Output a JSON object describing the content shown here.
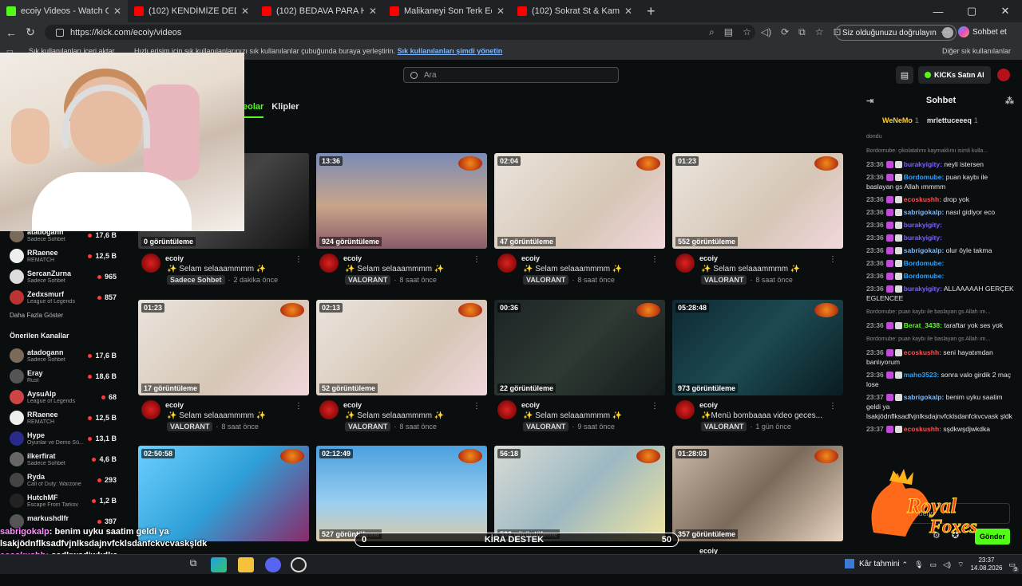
{
  "browser": {
    "tabs": [
      {
        "title": "ecoiy Videos - Watch On-Demand",
        "fav": "#53fc18"
      },
      {
        "title": "(102) KENDİMİZE DEDEKTİF TUTTU",
        "fav": "#ff0000"
      },
      {
        "title": "(102) BEDAVA PARA HİLESİ BULUP",
        "fav": "#ff0000"
      },
      {
        "title": "Malikaneyi Son Terk Eden Kazanır",
        "fav": "#ff0000"
      },
      {
        "title": "(102) Sokrat St & Kamufle & Ados",
        "fav": "#ff0000"
      }
    ],
    "url": "https://kick.com/ecoiy/videos",
    "verify_label": "Siz olduğunuzu doğrulayın",
    "copilot_label": "Sohbet et",
    "bookmarks": {
      "import": "Sık kullanılanları içeri aktar",
      "hint": "Hızlı erişim için sık kullanılanlarınızı sık kullanılanlar çubuğunda buraya yerleştirin.",
      "manage_link": "Sık kullanılanları şimdi yönetin",
      "other": "Diğer sık kullanılanlar"
    }
  },
  "header": {
    "search_placeholder": "Ara",
    "kicks_label": "KICKs Satın Al"
  },
  "content_tabs": {
    "videos": "eolar",
    "clips": "Klipler"
  },
  "sidebar": {
    "followed": [
      {
        "name": "atadogann",
        "category": "Sadece Sohbet",
        "viewers": "17,6 B",
        "color": "#7a6a5a"
      },
      {
        "name": "RRaenee",
        "category": "REMATCH",
        "viewers": "12,5 B",
        "color": "#eee"
      },
      {
        "name": "SercanZurna",
        "category": "Sadece Sohbet",
        "viewers": "965",
        "color": "#ddd"
      },
      {
        "name": "Zedxsmurf",
        "category": "League of Legends",
        "viewers": "857",
        "color": "#b33"
      }
    ],
    "show_more": "Daha Fazla Göster",
    "recommended_title": "Önerilen Kanallar",
    "recommended": [
      {
        "name": "atadogann",
        "category": "Sadece Sohbet",
        "viewers": "17,6 B",
        "color": "#7a6a5a"
      },
      {
        "name": "Eray",
        "category": "Rust",
        "viewers": "18,6 B",
        "color": "#555"
      },
      {
        "name": "AysuAlp",
        "category": "League of Legends",
        "viewers": "68",
        "color": "#c44"
      },
      {
        "name": "RRaenee",
        "category": "REMATCH",
        "viewers": "12,5 B",
        "color": "#eee"
      },
      {
        "name": "Hype",
        "category": "Oyunlar ve Demo Sü...",
        "viewers": "13,1 B",
        "color": "#2a2a8a"
      },
      {
        "name": "ilkerfirat",
        "category": "Sadece Sohbet",
        "viewers": "4,6 B",
        "color": "#666"
      },
      {
        "name": "Ryda",
        "category": "Call of Duty: Warzone",
        "viewers": "293",
        "color": "#444"
      },
      {
        "name": "HutchMF",
        "category": "Escape From Tarkov",
        "viewers": "1,2 B",
        "color": "#222"
      },
      {
        "name": "markushdlfr",
        "category": "",
        "viewers": "397",
        "color": "#555"
      }
    ]
  },
  "videos": [
    {
      "dur": "",
      "views": "0 görüntüleme",
      "channel": "ecoiy",
      "title": "✨ Selam selaaammmm ✨",
      "cat": "Sadece Sohbet",
      "ago": "2 dakika önce",
      "bg": "linear-gradient(135deg,#222,#444 50%,#111)"
    },
    {
      "dur": "13:36",
      "views": "924 görüntüleme",
      "channel": "ecoiy",
      "title": "✨ Selam selaaammmm ✨",
      "cat": "VALORANT",
      "ago": "8 saat önce",
      "bg": "linear-gradient(180deg,#7a8bb5,#c9a58a 55%,#8a5a6a)"
    },
    {
      "dur": "02:04",
      "views": "47 görüntüleme",
      "channel": "ecoiy",
      "title": "✨ Selam selaaammmm ✨",
      "cat": "VALORANT",
      "ago": "8 saat önce",
      "bg": "linear-gradient(135deg,#eae4dc,#d6c6b6 60%,#f2d7dc)"
    },
    {
      "dur": "01:23",
      "views": "552 görüntüleme",
      "channel": "ecoiy",
      "title": "✨ Selam selaaammmm ✨",
      "cat": "VALORANT",
      "ago": "8 saat önce",
      "bg": "linear-gradient(135deg,#eae4dc,#d6c6b6 60%,#f2d7dc)"
    },
    {
      "dur": "01:23",
      "views": "17 görüntüleme",
      "channel": "ecoiy",
      "title": "✨ Selam selaaammmm ✨",
      "cat": "VALORANT",
      "ago": "8 saat önce",
      "bg": "linear-gradient(135deg,#eae4dc,#d6c6b6 60%,#f2d7dc)"
    },
    {
      "dur": "02:13",
      "views": "52 görüntüleme",
      "channel": "ecoiy",
      "title": "✨ Selam selaaammmm ✨",
      "cat": "VALORANT",
      "ago": "8 saat önce",
      "bg": "linear-gradient(135deg,#eae4dc,#d6c6b6 60%,#f2d7dc)"
    },
    {
      "dur": "00:36",
      "views": "22 görüntüleme",
      "channel": "ecoiy",
      "title": "✨ Selam selaaammmm ✨",
      "cat": "VALORANT",
      "ago": "9 saat önce",
      "bg": "linear-gradient(135deg,#1e2326,#2e3a33 50%,#151a1c)"
    },
    {
      "dur": "05:28:48",
      "views": "973 görüntüleme",
      "channel": "ecoiy",
      "title": "✨Menü bombaaaa video geces...",
      "cat": "VALORANT",
      "ago": "1 gün önce",
      "bg": "linear-gradient(135deg,#0f2a33,#1d4a52 50%,#0a1c22)"
    },
    {
      "dur": "02:50:58",
      "views": "",
      "channel": "",
      "title": "",
      "cat": "",
      "ago": "",
      "bg": "linear-gradient(135deg,#6bd0ff,#2fa0d8 50%,#8a2a6a)"
    },
    {
      "dur": "02:12:49",
      "views": "527 görüntüleme",
      "channel": "",
      "title": "",
      "cat": "",
      "ago": "",
      "bg": "linear-gradient(180deg,#4aa0e0,#9acff0 60%,#d9c8a8)"
    },
    {
      "dur": "56:18",
      "views": "532 görüntüleme",
      "channel": "",
      "title": "",
      "cat": "",
      "ago": "",
      "bg": "linear-gradient(135deg,#d8dcd6,#9cb8c2 50%,#f2e6a0)"
    },
    {
      "dur": "01:28:03",
      "views": "357 görüntüleme",
      "channel": "ecoiy",
      "title": "",
      "cat": "",
      "ago": "",
      "bg": "linear-gradient(135deg,#c9b8a6,#7a6a5a 50%,#e8d4c0)"
    }
  ],
  "chat": {
    "title": "Sohbet",
    "pinned": [
      {
        "name": "WeNeMo",
        "count": "1"
      },
      {
        "name": "mrlettuceeeq",
        "count": "1"
      }
    ],
    "messages": [
      {
        "sys": "dondu",
        "time": "",
        "user": "",
        "color": "",
        "text": ""
      },
      {
        "sys": "Bordomube: çikolatalımı kaymaklımı isimli kulla...",
        "time": "",
        "user": "",
        "color": "",
        "text": ""
      },
      {
        "sys": "",
        "time": "23:36",
        "user": "burakyigity:",
        "color": "#7b61ff",
        "text": "neyli istersen"
      },
      {
        "sys": "",
        "time": "23:36",
        "user": "Bordomube:",
        "color": "#2aa3ff",
        "text": "puan kaybı ile baslayan gs Allah ımmmm"
      },
      {
        "sys": "",
        "time": "23:36",
        "user": "ecoskushh:",
        "color": "#ff4d4d",
        "text": "drop yok"
      },
      {
        "sys": "",
        "time": "23:36",
        "user": "sabrigokalp:",
        "color": "#7ab7ff",
        "text": "nasıl gidiyor eco"
      },
      {
        "sys": "",
        "time": "23:36",
        "user": "burakyigity:",
        "color": "#7b61ff",
        "text": ""
      },
      {
        "sys": "",
        "time": "23:36",
        "user": "burakyigity:",
        "color": "#7b61ff",
        "text": ""
      },
      {
        "sys": "",
        "time": "23:36",
        "user": "sabrigokalp:",
        "color": "#7ab7ff",
        "text": "olur öyle takma"
      },
      {
        "sys": "",
        "time": "23:36",
        "user": "Bordomube:",
        "color": "#2aa3ff",
        "text": ""
      },
      {
        "sys": "",
        "time": "23:36",
        "user": "Bordomube:",
        "color": "#2aa3ff",
        "text": ""
      },
      {
        "sys": "",
        "time": "23:36",
        "user": "burakyigity:",
        "color": "#7b61ff",
        "text": "ALLAAAAAH GERÇEK EGLENCEE"
      },
      {
        "sys": "Bordomube: puan kaybı ile baslayan gs Allah ım...",
        "time": "",
        "user": "",
        "color": "",
        "text": ""
      },
      {
        "sys": "",
        "time": "23:36",
        "user": "Berat_3438:",
        "color": "#53fc18",
        "text": "taraftar yok ses yok"
      },
      {
        "sys": "Bordomube: puan kaybı ile baslayan gs Allah ım...",
        "time": "",
        "user": "",
        "color": "",
        "text": ""
      },
      {
        "sys": "",
        "time": "23:36",
        "user": "ecoskushh:",
        "color": "#ff4d4d",
        "text": "seni hayatımdan banlıyorum"
      },
      {
        "sys": "",
        "time": "23:36",
        "user": "maho3523:",
        "color": "#2aa3ff",
        "text": "sonra valo girdik 2 maç lose"
      },
      {
        "sys": "",
        "time": "23:37",
        "user": "sabrigokalp:",
        "color": "#7ab7ff",
        "text": "benim uyku saatim geldi ya lsakjödnflksadfvjnlksdajnvfcklsdanfckvcvask şldk"
      },
      {
        "sys": "",
        "time": "23:37",
        "user": "ecoskushh:",
        "color": "#ff4d4d",
        "text": "sşdkwşdjwkdka"
      }
    ],
    "input_placeholder": "Mesaj gönderin",
    "send_label": "Gönder"
  },
  "overlay": {
    "chat_lines": [
      {
        "user": "sabrigokalp",
        "text": ": benim uyku saatim geldi ya"
      },
      {
        "user": "",
        "text": "lsakjödnflksadfvjnlksdajnvfcklsdanfckvcvaskşldk"
      },
      {
        "user": "ecoskushh",
        "text": ": sşdkwşdjwkdka"
      }
    ],
    "donation": {
      "min": "0",
      "label": "KİRA DESTEK",
      "max": "50",
      "progress": 0
    },
    "logo_text": "Royal Foxes"
  },
  "taskbar": {
    "weather": "Kâr tahmini",
    "time": "23:37",
    "date": "14.08.2026",
    "notif": "9"
  }
}
